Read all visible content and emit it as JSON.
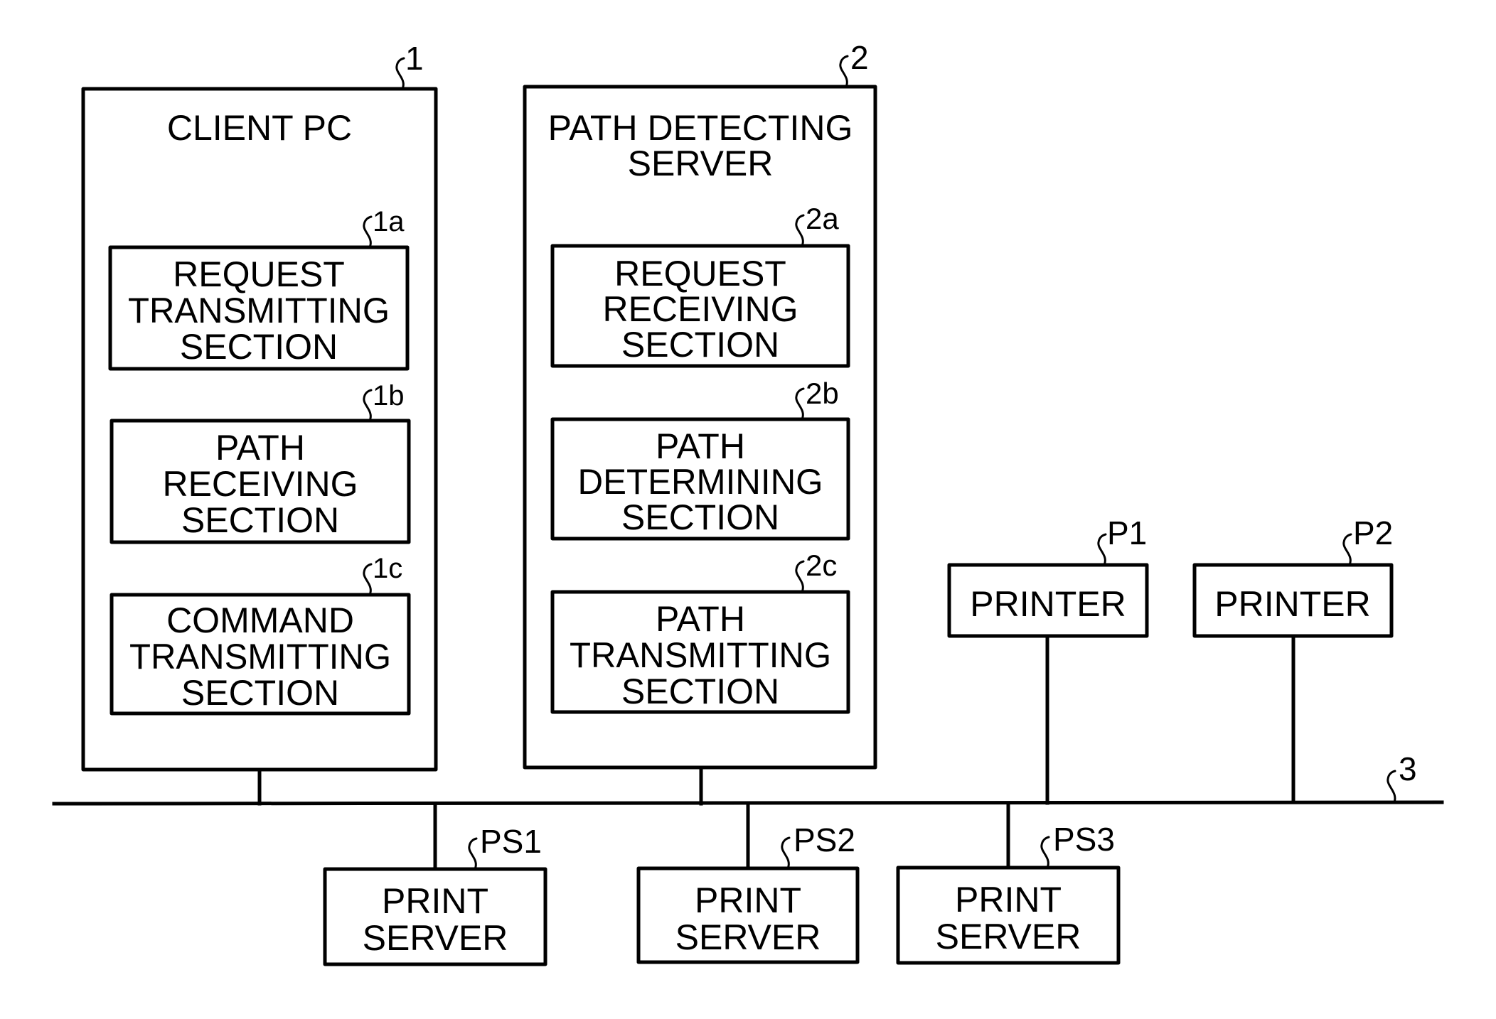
{
  "diagram": {
    "client_pc": {
      "ref": "1",
      "title": [
        "CLIENT PC"
      ],
      "sections": [
        {
          "ref": "1a",
          "lines": [
            "REQUEST",
            "TRANSMITTING",
            "SECTION"
          ]
        },
        {
          "ref": "1b",
          "lines": [
            "PATH",
            "RECEIVING",
            "SECTION"
          ]
        },
        {
          "ref": "1c",
          "lines": [
            "COMMAND",
            "TRANSMITTING",
            "SECTION"
          ]
        }
      ]
    },
    "path_detecting_server": {
      "ref": "2",
      "title": [
        "PATH DETECTING",
        "SERVER"
      ],
      "sections": [
        {
          "ref": "2a",
          "lines": [
            "REQUEST",
            "RECEIVING",
            "SECTION"
          ]
        },
        {
          "ref": "2b",
          "lines": [
            "PATH",
            "DETERMINING",
            "SECTION"
          ]
        },
        {
          "ref": "2c",
          "lines": [
            "PATH",
            "TRANSMITTING",
            "SECTION"
          ]
        }
      ]
    },
    "network": {
      "ref": "3"
    },
    "printers": [
      {
        "ref": "P1",
        "label": "PRINTER"
      },
      {
        "ref": "P2",
        "label": "PRINTER"
      }
    ],
    "print_servers": [
      {
        "ref": "PS1",
        "lines": [
          "PRINT",
          "SERVER"
        ]
      },
      {
        "ref": "PS2",
        "lines": [
          "PRINT",
          "SERVER"
        ]
      },
      {
        "ref": "PS3",
        "lines": [
          "PRINT",
          "SERVER"
        ]
      }
    ]
  }
}
